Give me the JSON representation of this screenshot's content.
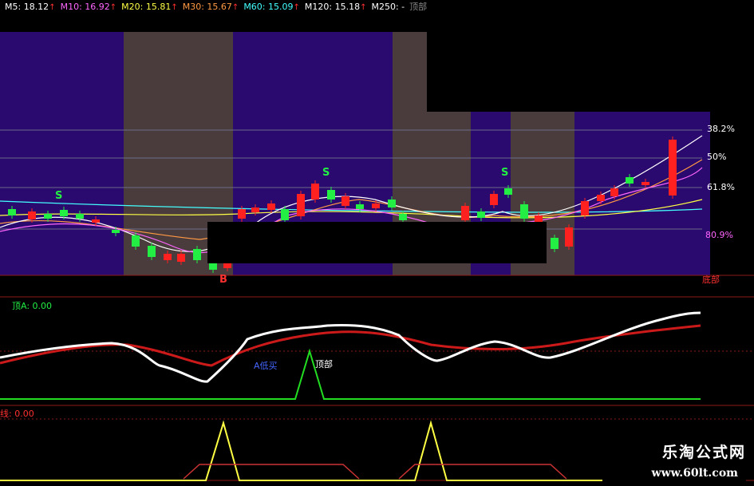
{
  "ma_legend": [
    {
      "label": "M5: 18.12",
      "color": "#ffffff"
    },
    {
      "label": "M10: 16.92",
      "color": "#ff66ff"
    },
    {
      "label": "M20: 15.81",
      "color": "#ffff44"
    },
    {
      "label": "M30: 15.67",
      "color": "#ff9944"
    },
    {
      "label": "M60: 15.09",
      "color": "#44ffff"
    },
    {
      "label": "M120: 15.18",
      "color": "#ffffff"
    },
    {
      "label": "M250: -",
      "color": "#ffffff"
    },
    {
      "label": "顶部",
      "color": "#888888"
    }
  ],
  "fib_levels": {
    "l382": "38.2%",
    "l50": "50%",
    "l618": "61.8%",
    "l809": "80.9%"
  },
  "bottom_label": "底部",
  "signals": {
    "s": "S",
    "b": "B"
  },
  "panel2": {
    "title": "顶A: 0.00",
    "note_low": "A低买",
    "note_top": "顶部"
  },
  "panel3": {
    "title": "线: 0.00"
  },
  "watermark": {
    "name": "乐淘公式网",
    "url": "www.60lt.com"
  },
  "colors": {
    "bg": "#000000",
    "purple": "#2a0a6e",
    "brown": "#4a3c3c",
    "up": "#ff2020",
    "down": "#22ee44",
    "grid": "#8b1a1a"
  }
}
